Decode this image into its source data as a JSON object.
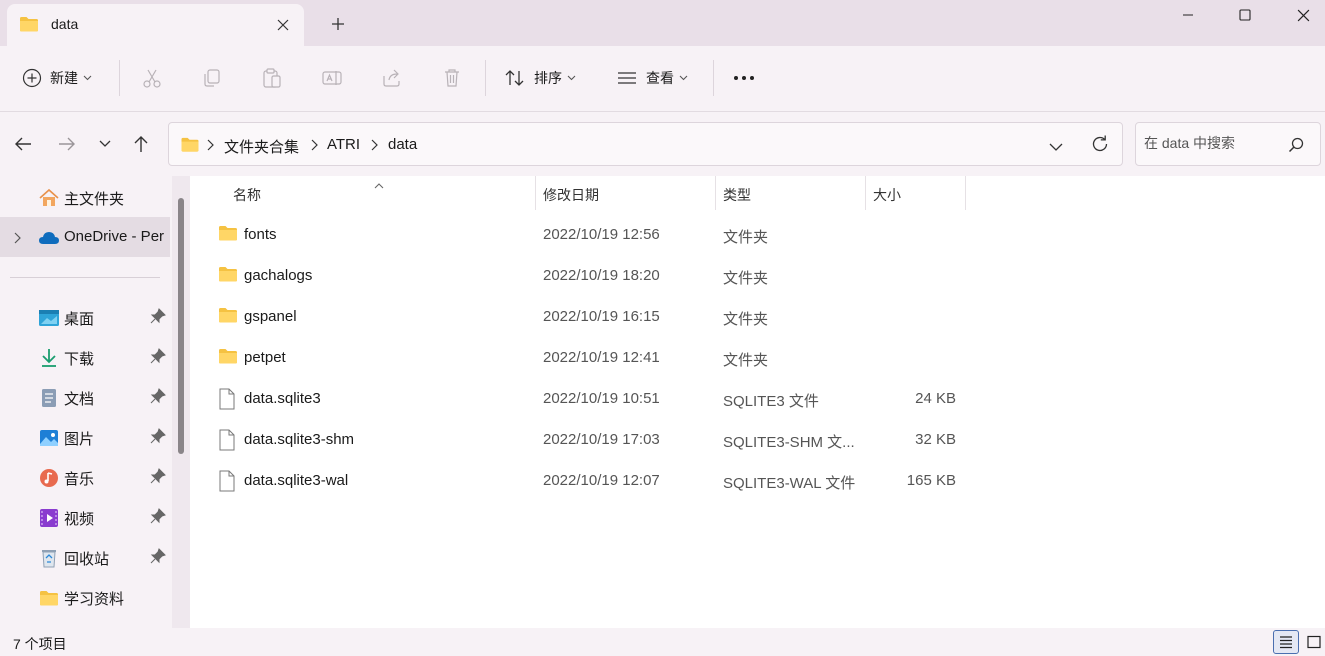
{
  "window": {
    "tab_title": "data"
  },
  "toolbar": {
    "new_label": "新建",
    "sort_label": "排序",
    "view_label": "查看"
  },
  "address": {
    "crumbs": [
      "文件夹合集",
      "ATRI",
      "data"
    ],
    "search_placeholder": "在 data 中搜索"
  },
  "sidebar": {
    "items": [
      {
        "label": "主文件夹",
        "icon": "home-icon"
      },
      {
        "label": "OneDrive - Per",
        "icon": "cloud-icon"
      },
      {
        "label": "桌面",
        "icon": "desktop-icon"
      },
      {
        "label": "下载",
        "icon": "download-icon"
      },
      {
        "label": "文档",
        "icon": "document-icon"
      },
      {
        "label": "图片",
        "icon": "pictures-icon"
      },
      {
        "label": "音乐",
        "icon": "music-icon"
      },
      {
        "label": "视频",
        "icon": "video-icon"
      },
      {
        "label": "回收站",
        "icon": "recycle-bin-icon"
      },
      {
        "label": "学习资料",
        "icon": "folder-icon"
      }
    ]
  },
  "columns": {
    "name": "名称",
    "modified": "修改日期",
    "type": "类型",
    "size": "大小"
  },
  "files": [
    {
      "name": "fonts",
      "modified": "2022/10/19 12:56",
      "type": "文件夹",
      "size": "",
      "kind": "folder"
    },
    {
      "name": "gachalogs",
      "modified": "2022/10/19 18:20",
      "type": "文件夹",
      "size": "",
      "kind": "folder"
    },
    {
      "name": "gspanel",
      "modified": "2022/10/19 16:15",
      "type": "文件夹",
      "size": "",
      "kind": "folder"
    },
    {
      "name": "petpet",
      "modified": "2022/10/19 12:41",
      "type": "文件夹",
      "size": "",
      "kind": "folder"
    },
    {
      "name": "data.sqlite3",
      "modified": "2022/10/19 10:51",
      "type": "SQLITE3 文件",
      "size": "24 KB",
      "kind": "file"
    },
    {
      "name": "data.sqlite3-shm",
      "modified": "2022/10/19 17:03",
      "type": "SQLITE3-SHM 文...",
      "size": "32 KB",
      "kind": "file"
    },
    {
      "name": "data.sqlite3-wal",
      "modified": "2022/10/19 12:07",
      "type": "SQLITE3-WAL 文件",
      "size": "165 KB",
      "kind": "file"
    }
  ],
  "status": {
    "item_count": "7 个项目"
  },
  "colors": {
    "folder": "#f5c242",
    "accent": "#0067c0",
    "chrome": "#f7f2f6",
    "titlebar": "#e9dfe8"
  }
}
